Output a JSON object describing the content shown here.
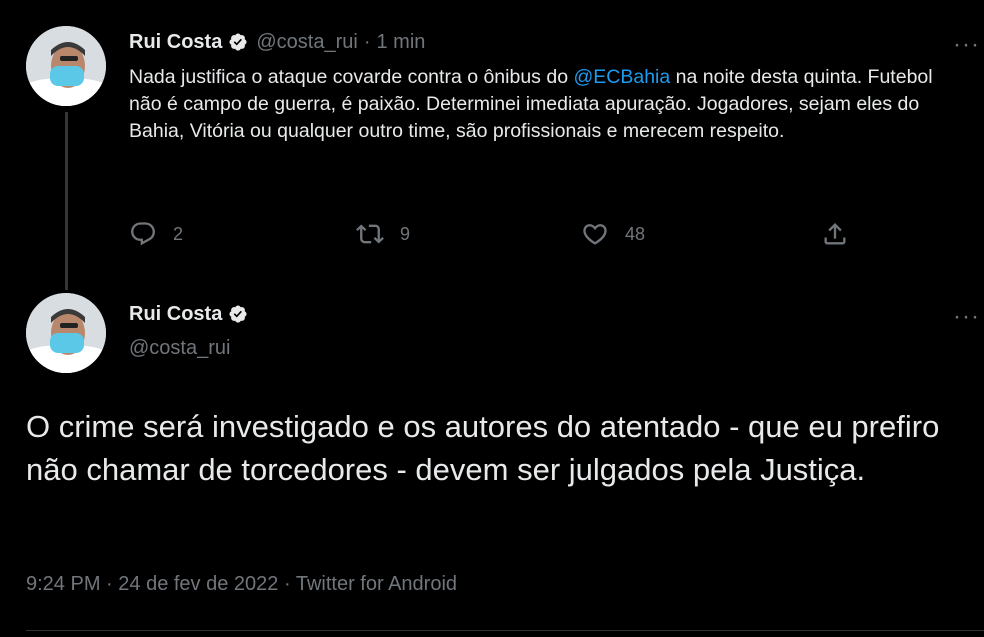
{
  "tweet1": {
    "name": "Rui Costa",
    "handle": "@costa_rui",
    "dot": "·",
    "time": "1 min",
    "more": "···",
    "text_before": "Nada justifica o ataque covarde contra o ônibus do ",
    "mention": "@ECBahia",
    "text_after": " na noite desta quinta. Futebol não é campo de guerra, é paixão. Determinei imediata apuração. Jogadores, sejam eles do Bahia, Vitória ou qualquer outro time, são profissionais e merecem respeito.",
    "replies": "2",
    "retweets": "9",
    "likes": "48"
  },
  "tweet2": {
    "name": "Rui Costa",
    "handle": "@costa_rui",
    "more": "···",
    "text": "O crime será investigado e os autores do atentado - que eu prefiro não chamar de torcedores - devem ser julgados pela Justiça.",
    "time": "9:24 PM",
    "dot1": " · ",
    "date": "24 de fev de 2022",
    "dot2": " · ",
    "source": "Twitter for Android"
  },
  "icons": {
    "verified": "verified-badge-icon",
    "reply": "reply-icon",
    "retweet": "retweet-icon",
    "like": "heart-icon",
    "share": "share-icon"
  },
  "colors": {
    "background": "#000000",
    "text": "#e7e9ea",
    "secondary": "#71767b",
    "link": "#1d9bf0"
  }
}
